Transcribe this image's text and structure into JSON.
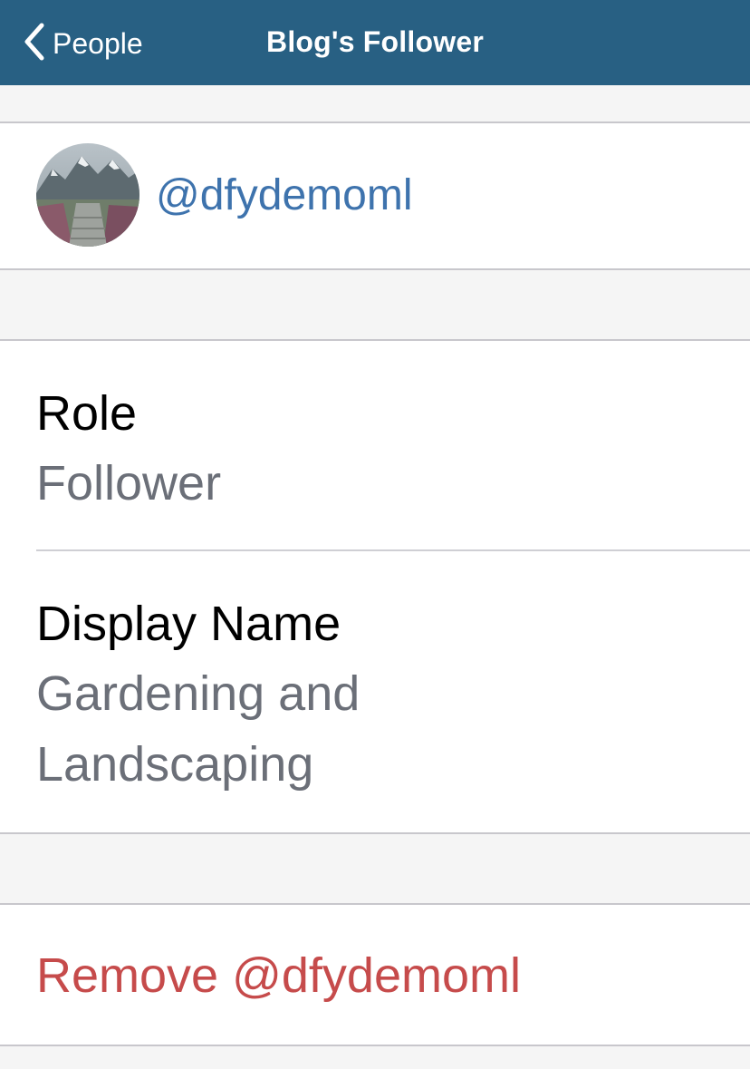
{
  "nav": {
    "back_label": "People",
    "title": "Blog's Follower",
    "bar_color": "#286083"
  },
  "profile": {
    "username": "@dfydemoml",
    "avatar": "mountain-path-photo"
  },
  "details": {
    "role_label": "Role",
    "role_value": "Follower",
    "display_name_label": "Display Name",
    "display_name_value_line1": "Gardening and",
    "display_name_value_line2": "Landscaping"
  },
  "actions": {
    "remove_label": "Remove @dfydemoml",
    "remove_color": "#c64b4b"
  }
}
